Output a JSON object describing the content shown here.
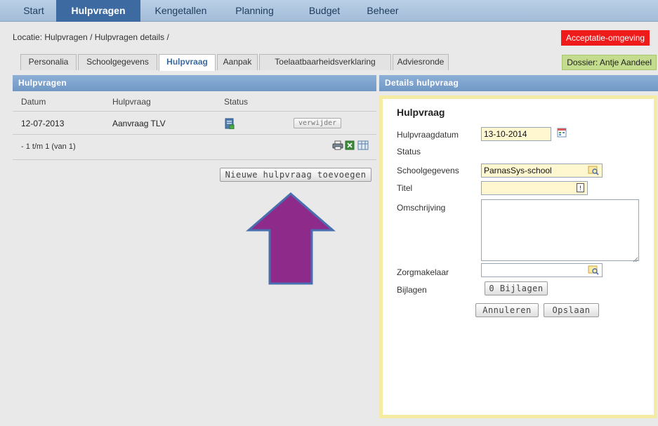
{
  "nav": {
    "items": [
      "Start",
      "Hulpvragen",
      "Kengetallen",
      "Planning",
      "Budget",
      "Beheer"
    ],
    "active_index": 1
  },
  "breadcrumb": "Locatie: Hulpvragen / Hulpvragen details /",
  "env_badge": "Acceptatie-omgeving",
  "dossier_badge": "Dossier: Antje Aandeel",
  "tabs": {
    "items": [
      "Personalia",
      "Schoolgegevens",
      "Hulpvraag",
      "Aanpak",
      "Toelaatbaarheidsverklaring",
      "Adviesronde"
    ],
    "active_index": 2
  },
  "list_panel": {
    "title": "Hulpvragen",
    "columns": [
      "Datum",
      "Hulpvraag",
      "Status"
    ],
    "rows": [
      {
        "datum": "12-07-2013",
        "hulpvraag": "Aanvraag TLV",
        "action": "verwijder"
      }
    ],
    "pager": "- 1 t/m 1 (van 1)",
    "add_button": "Nieuwe hulpvraag toevoegen"
  },
  "details_panel": {
    "title": "Details hulpvraag",
    "form_title": "Hulpvraag",
    "labels": {
      "datum": "Hulpvraagdatum",
      "status": "Status",
      "school": "Schoolgegevens",
      "titel": "Titel",
      "omschrijving": "Omschrijving",
      "zorgmakelaar": "Zorgmakelaar",
      "bijlagen": "Bijlagen"
    },
    "values": {
      "datum": "13-10-2014",
      "school": "ParnasSys-school",
      "titel": "",
      "omschrijving": "",
      "zorgmakelaar": ""
    },
    "bijlagen_button": "0 Bijlagen",
    "cancel_button": "Annuleren",
    "save_button": "Opslaan"
  },
  "colors": {
    "nav_active": "#3e6aa2",
    "env_badge": "#ef1b1b",
    "dossier_badge": "#c4dc8e",
    "arrow": "#8e2a8a",
    "input_highlight": "#fff7cf"
  }
}
